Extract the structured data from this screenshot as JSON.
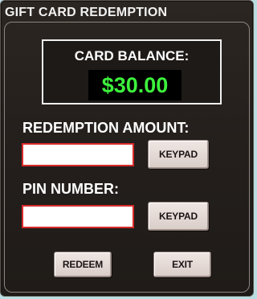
{
  "header": {
    "title": "GIFT CARD REDEMPTION"
  },
  "balance": {
    "label": "CARD BALANCE:",
    "value": "$30.00"
  },
  "redemption": {
    "label": "REDEMPTION AMOUNT:",
    "value": "",
    "keypad_label": "KEYPAD"
  },
  "pin": {
    "label": "PIN NUMBER:",
    "value": "",
    "keypad_label": "KEYPAD"
  },
  "actions": {
    "redeem_label": "REDEEM",
    "exit_label": "EXIT"
  },
  "colors": {
    "panel_bg": "#241f1c",
    "balance_text": "#3df23d",
    "input_border": "#d82a2a",
    "page_bg": "#b9dde0"
  }
}
